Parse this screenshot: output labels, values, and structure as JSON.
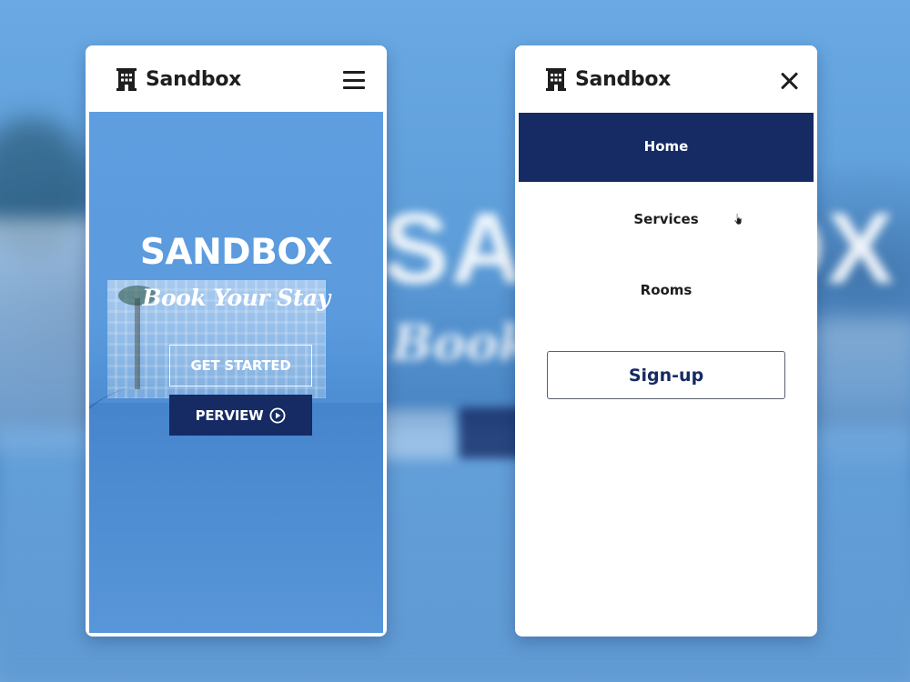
{
  "brand": {
    "name": "Sandbox",
    "icon": "hotel-building-icon"
  },
  "left_screen": {
    "menu_icon": "hamburger-menu-icon",
    "hero": {
      "title": "SANDBOX",
      "tagline": "Book Your Stay",
      "get_started_label": "GET STARTED",
      "perview_label": "PERVIEW",
      "perview_icon": "play-circle-icon"
    }
  },
  "right_screen": {
    "close_icon": "close-icon",
    "menu": {
      "items": [
        {
          "label": "Home",
          "active": true
        },
        {
          "label": "Services",
          "active": false
        },
        {
          "label": "Rooms",
          "active": false
        }
      ],
      "signup_label": "Sign-up"
    }
  },
  "colors": {
    "navy": "#162a64",
    "background_blue": "#5b9bd8",
    "white": "#ffffff",
    "text_dark": "#1e1e1e"
  }
}
